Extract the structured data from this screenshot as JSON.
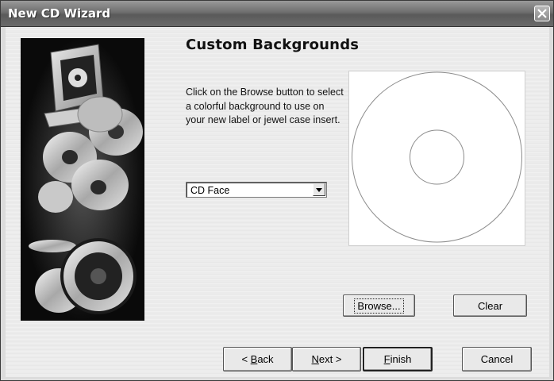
{
  "window": {
    "title": "New CD Wizard",
    "close_icon": "close-x-icon"
  },
  "page": {
    "heading": "Custom Backgrounds",
    "instructions": "Click on the Browse button to select a colorful background to use on your new label or jewel case insert.",
    "target_select": {
      "selected": "CD Face",
      "arrow_icon": "dropdown-arrow-icon"
    }
  },
  "buttons": {
    "browse": "Browse...",
    "clear": "Clear",
    "back": {
      "pre": "< ",
      "accel": "B",
      "post": "ack"
    },
    "next": {
      "accel": "N",
      "post": "ext >"
    },
    "finish": {
      "accel": "F",
      "post": "inish"
    },
    "cancel": "Cancel"
  },
  "colors": {
    "titlebar": "#6e6e6e",
    "client_bg": "#ececec",
    "sidebar_bg": "#141414",
    "preview_bg": "#ffffff",
    "disc_outline": "#8c8c8c"
  }
}
